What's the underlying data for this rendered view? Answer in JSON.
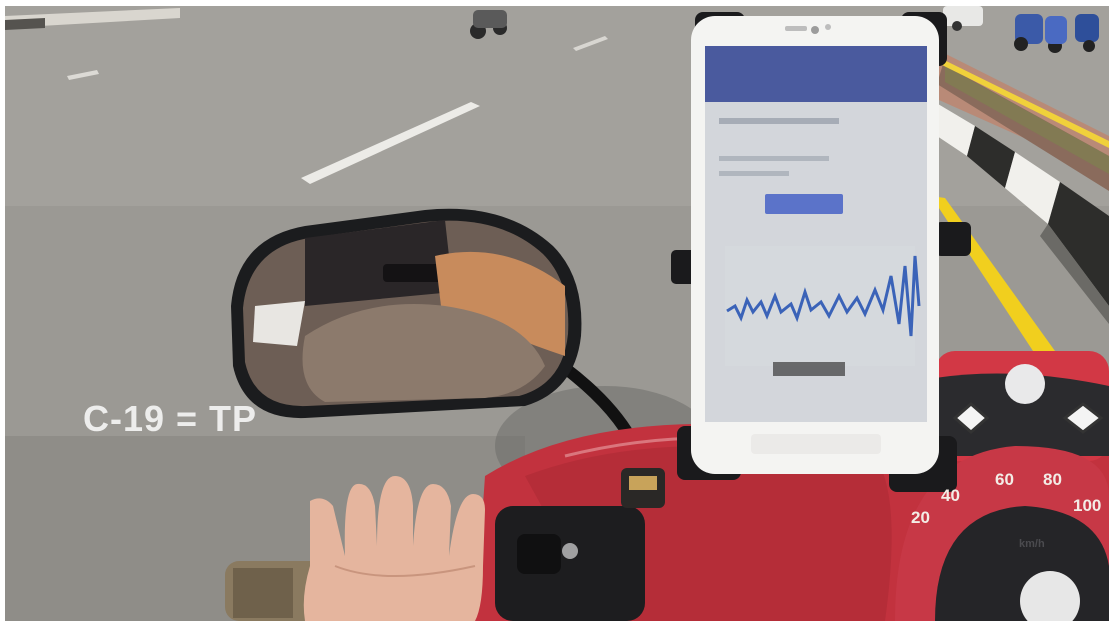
{
  "caption": "C-19 = TP",
  "phone_screen": {
    "title": "",
    "button": ""
  },
  "speedometer": {
    "numbers": [
      "20",
      "40",
      "60",
      "80",
      "100"
    ],
    "unit": "km/h"
  },
  "colors": {
    "road": "#9a9893",
    "scooter_body": "#c2323e",
    "phone_header": "#4a5a9e",
    "waveform": "#3b63b8",
    "road_line_yellow": "#f1cf1e"
  }
}
